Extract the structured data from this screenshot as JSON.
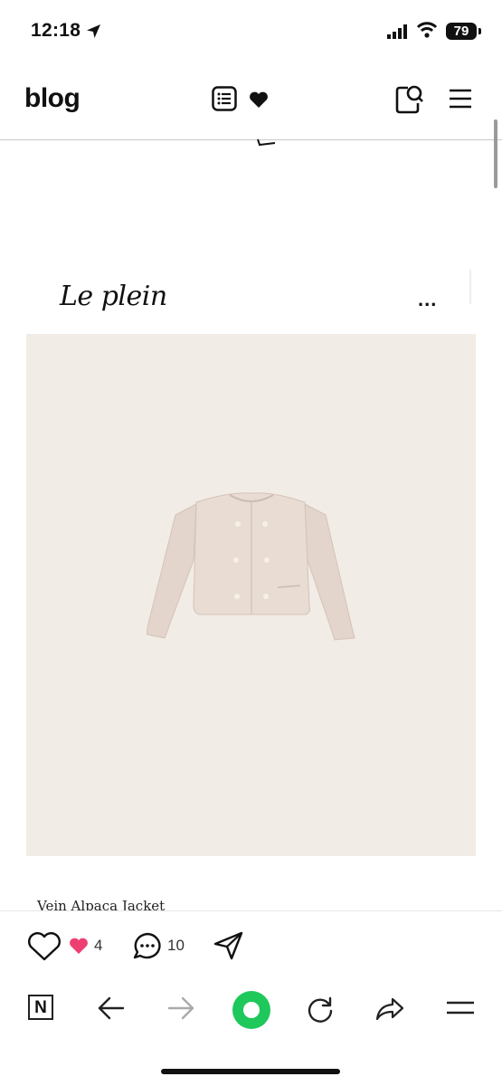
{
  "status_bar": {
    "time": "12:18",
    "battery": "79"
  },
  "header": {
    "title": "blog"
  },
  "post": {
    "brand": "Le plein",
    "more": "...",
    "product_name": "Vein Alpaca Jacket"
  },
  "reactions": {
    "like_count": "4",
    "comment_count": "10"
  },
  "toolbar": {
    "n_label": "N"
  },
  "colors": {
    "accent_green": "#1ec85a",
    "like_pink": "#ee3f72",
    "image_bg": "#f2ece6"
  }
}
